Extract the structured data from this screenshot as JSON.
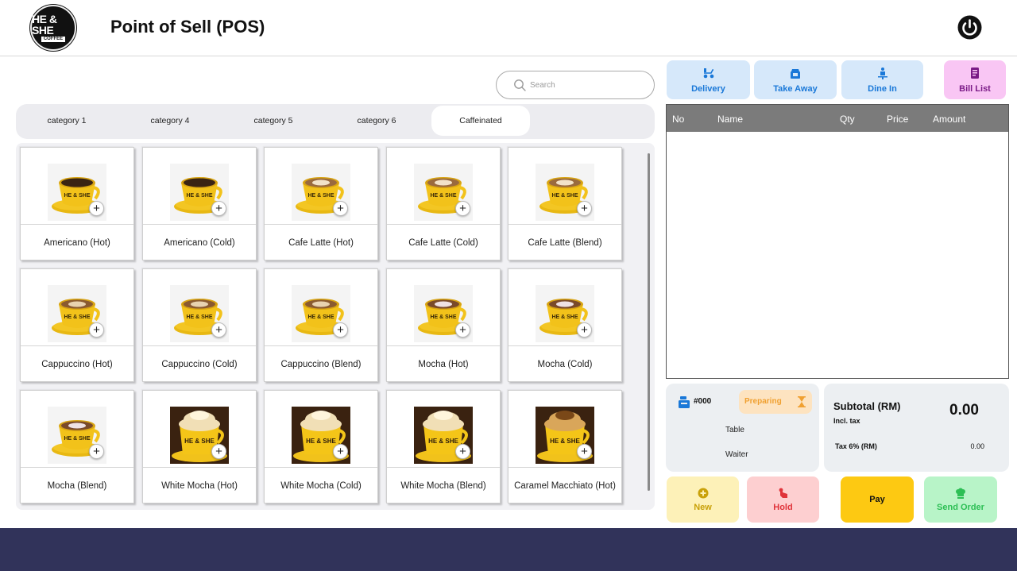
{
  "header": {
    "logo_text": "HE & SHE",
    "logo_subtext": "COFFEE",
    "title": "Point of Sell (POS)",
    "power_icon": "power-icon"
  },
  "search": {
    "placeholder": "Search",
    "value": ""
  },
  "categories": [
    {
      "label": "category 1",
      "active": false
    },
    {
      "label": "category 4",
      "active": false
    },
    {
      "label": "category 5",
      "active": false
    },
    {
      "label": "category 6",
      "active": false
    },
    {
      "label": "Caffeinated",
      "active": true
    }
  ],
  "products": [
    {
      "name": "Americano (Hot)",
      "style": "black"
    },
    {
      "name": "Americano (Cold)",
      "style": "black"
    },
    {
      "name": "Cafe Latte (Hot)",
      "style": "latte"
    },
    {
      "name": "Cafe Latte (Cold)",
      "style": "latte"
    },
    {
      "name": "Cafe Latte (Blend)",
      "style": "latte"
    },
    {
      "name": "Cappuccino (Hot)",
      "style": "cappuccino"
    },
    {
      "name": "Cappuccino (Cold)",
      "style": "cappuccino"
    },
    {
      "name": "Cappuccino (Blend)",
      "style": "cappuccino"
    },
    {
      "name": "Mocha (Hot)",
      "style": "mocha"
    },
    {
      "name": "Mocha (Cold)",
      "style": "mocha"
    },
    {
      "name": "Mocha (Blend)",
      "style": "mocha"
    },
    {
      "name": "White Mocha (Hot)",
      "style": "cream"
    },
    {
      "name": "White Mocha (Cold)",
      "style": "cream"
    },
    {
      "name": "White Mocha (Blend)",
      "style": "cream"
    },
    {
      "name": "Caramel Macchiato (Hot)",
      "style": "caramel"
    }
  ],
  "order_types": {
    "delivery": "Delivery",
    "take_away": "Take Away",
    "dine_in": "Dine In",
    "bill_list": "Bill List"
  },
  "order_table": {
    "columns": [
      "No",
      "Name",
      "Qty",
      "Price",
      "Amount"
    ],
    "rows": []
  },
  "order_info": {
    "order_no": "#000",
    "status": "Preparing",
    "table_label": "Table",
    "waiter_label": "Waiter"
  },
  "totals": {
    "subtotal_label": "Subtotal (RM)",
    "incl_tax": "Incl. tax",
    "subtotal_value": "0.00",
    "tax_label": "Tax 6% (RM)",
    "tax_value": "0.00"
  },
  "actions": {
    "new": "New",
    "hold": "Hold",
    "pay": "Pay",
    "send_order": "Send Order"
  },
  "colors": {
    "footer": "#31335a",
    "accent_blue": "#1a78d8",
    "bill_pink": "#f9c6f4",
    "pay_yellow": "#fdc912",
    "send_green": "#b8f4c8",
    "hold_red": "#fdcfd0",
    "new_yellow": "#fdf1b8",
    "preparing_orange": "#f0a030"
  }
}
